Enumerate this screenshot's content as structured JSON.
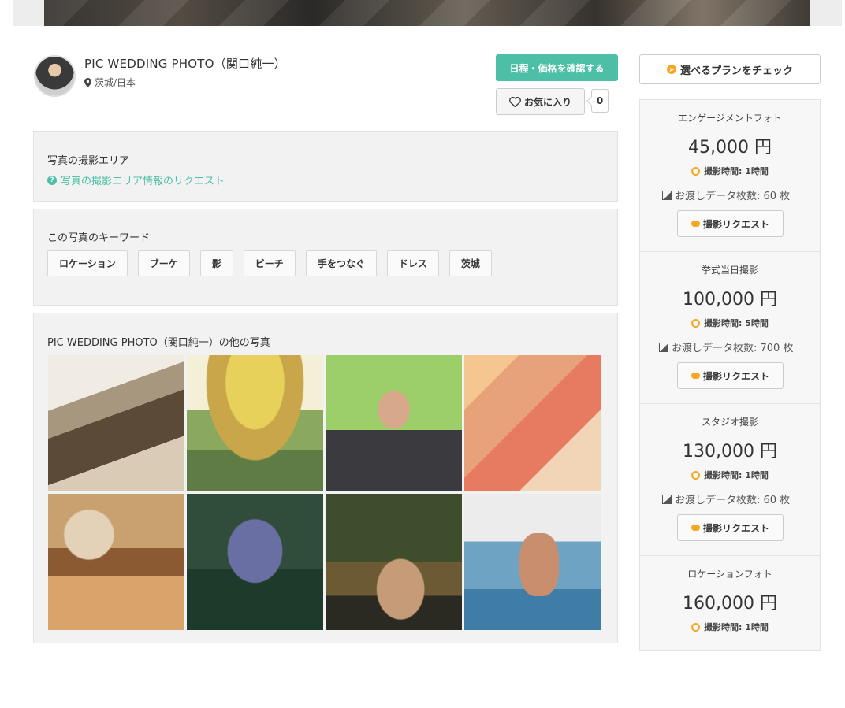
{
  "profile": {
    "name": "PIC WEDDING PHOTO（関口純一）",
    "location": "茨城/日本"
  },
  "actions": {
    "schedule_label": "日程・価格を確認する",
    "favorite_label": "お気に入り",
    "favorite_count": "0"
  },
  "area": {
    "title": "写真の撮影エリア",
    "request_link": "写真の撮影エリア情報のリクエスト"
  },
  "keywords": {
    "title": "この写真のキーワード",
    "items": [
      "ロケーション",
      "ブーケ",
      "影",
      "ビーチ",
      "手をつなぐ",
      "ドレス",
      "茨城"
    ]
  },
  "others": {
    "title": "PIC WEDDING PHOTO（関口純一）の他の写真"
  },
  "sidebar": {
    "plans_button": "選べるプランをチェック",
    "plans": [
      {
        "name": "エンゲージメントフォト",
        "price": "45,000 円",
        "time": "撮影時間: 1時間",
        "data": "お渡しデータ枚数: 60 枚",
        "request": "撮影リクエスト"
      },
      {
        "name": "挙式当日撮影",
        "price": "100,000 円",
        "time": "撮影時間: 5時間",
        "data": "お渡しデータ枚数: 700 枚",
        "request": "撮影リクエスト"
      },
      {
        "name": "スタジオ撮影",
        "price": "130,000 円",
        "time": "撮影時間: 1時間",
        "data": "お渡しデータ枚数: 60 枚",
        "request": "撮影リクエスト"
      },
      {
        "name": "ロケーションフォト",
        "price": "160,000 円",
        "time": "撮影時間: 1時間",
        "data": "",
        "request": ""
      }
    ]
  }
}
